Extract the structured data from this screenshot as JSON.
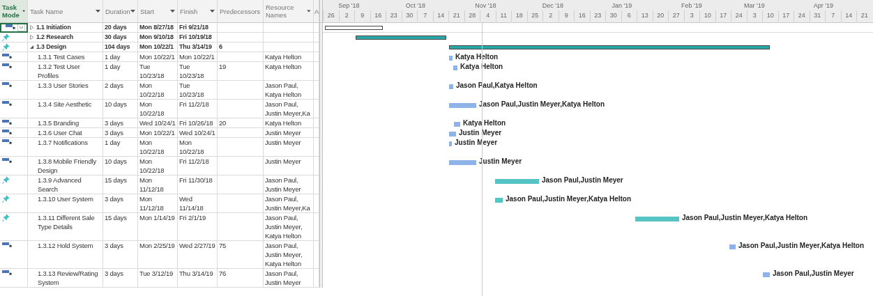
{
  "columns": [
    {
      "label": "Task Mode",
      "selected": true,
      "kind": "field"
    },
    {
      "label": "Task Name",
      "selected": false,
      "kind": "field"
    },
    {
      "label": "Duration",
      "selected": false,
      "kind": "field"
    },
    {
      "label": "Start",
      "selected": false,
      "kind": "field"
    },
    {
      "label": "Finish",
      "selected": false,
      "kind": "field"
    },
    {
      "label": "Predecessors",
      "selected": false,
      "kind": "field"
    },
    {
      "label": "Resource Names",
      "selected": false,
      "kind": "field"
    },
    {
      "label": "A",
      "selected": false,
      "kind": "add"
    }
  ],
  "timescale": {
    "months": [
      "Sep '18",
      "Oct '18",
      "Nov '18",
      "Dec '18",
      "Jan '19",
      "Feb '19",
      "Mar '19",
      "Apr '19"
    ],
    "weeks": [
      "26",
      "2",
      "9",
      "16",
      "23",
      "30",
      "7",
      "14",
      "21",
      "28",
      "4",
      "11",
      "18",
      "25",
      "2",
      "9",
      "16",
      "23",
      "30",
      "6",
      "13",
      "20",
      "27",
      "3",
      "10",
      "17",
      "24",
      "3",
      "10",
      "17",
      "24",
      "31",
      "7",
      "14",
      "21"
    ]
  },
  "rows": [
    {
      "kind": "auto",
      "selected": true,
      "summary": true,
      "expanded": false,
      "name": "1.1 Initiation",
      "duration": "20 days",
      "start": "Mon 8/27/18",
      "finish": "Fri 9/21/18"
    },
    {
      "kind": "manual",
      "selected": false,
      "summary": true,
      "expanded": false,
      "name": "1.2 Research",
      "duration": "30 days",
      "start": "Mon 9/10/18",
      "finish": "Fri 10/19/18"
    },
    {
      "kind": "manual",
      "selected": false,
      "summary": true,
      "expanded": true,
      "name": "1.3 Design",
      "duration": "104 days",
      "start": "Mon 10/22/1",
      "finish": "Thu 3/14/19",
      "predecessors": "6"
    },
    {
      "kind": "auto",
      "selected": false,
      "summary": false,
      "name": "1.3.1 Test Cases",
      "duration": "1 day",
      "start": "Mon 10/22/1",
      "finish": "Mon 10/22/1",
      "resources": "Katya Helton",
      "bar_label": "Katya Helton"
    },
    {
      "kind": "auto",
      "selected": false,
      "summary": false,
      "name": "1.3.2 Test User Profiles",
      "duration": "1 day",
      "start": "Tue 10/23/18",
      "finish": "Tue 10/23/18",
      "predecessors": "19",
      "resources": "Katya Helton",
      "bar_label": "Katya Helton"
    },
    {
      "kind": "auto",
      "selected": false,
      "summary": false,
      "name": "1.3.3 User Stories",
      "duration": "2 days",
      "start": "Mon 10/22/18",
      "finish": "Tue 10/23/18",
      "resources": "Jason Paul, Katya Helton",
      "bar_label": "Jason Paul,Katya Helton"
    },
    {
      "kind": "auto",
      "selected": false,
      "summary": false,
      "name": "1.3.4 Site Aesthetic",
      "duration": "10 days",
      "start": "Mon 10/22/18",
      "finish": "Fri 11/2/18",
      "resources": "Jason Paul, Justin Meyer,Ka",
      "bar_label": "Jason Paul,Justin Meyer,Katya Helton"
    },
    {
      "kind": "auto",
      "selected": false,
      "summary": false,
      "name": "1.3.5 Branding",
      "duration": "3 days",
      "start": "Wed 10/24/1",
      "finish": "Fri 10/26/18",
      "predecessors": "20",
      "resources": "Katya Helton",
      "bar_label": "Katya Helton"
    },
    {
      "kind": "auto",
      "selected": false,
      "summary": false,
      "name": "1.3.6 User Chat",
      "duration": "3 days",
      "start": "Mon 10/22/1",
      "finish": "Wed 10/24/1",
      "resources": "Justin Meyer",
      "bar_label": "Justin Meyer"
    },
    {
      "kind": "auto",
      "selected": false,
      "summary": false,
      "name": "1.3.7 Notifications",
      "duration": "1 day",
      "start": "Mon 10/22/18",
      "finish": "Mon 10/22/18",
      "resources": "Justin Meyer",
      "bar_label": "Justin Meyer"
    },
    {
      "kind": "auto",
      "selected": false,
      "summary": false,
      "name": "1.3.8 Mobile Friendly Design",
      "duration": "10 days",
      "start": "Mon 10/22/18",
      "finish": "Fri 11/2/18",
      "resources": "Justin Meyer",
      "bar_label": "Justin Meyer"
    },
    {
      "kind": "manual",
      "selected": false,
      "summary": false,
      "name": "1.3.9 Advanced Search",
      "duration": "15 days",
      "start": "Mon 11/12/18",
      "finish": "Fri 11/30/18",
      "resources": "Jason Paul, Justin Meyer",
      "bar_label": "Jason Paul,Justin Meyer"
    },
    {
      "kind": "manual",
      "selected": false,
      "summary": false,
      "name": "1.3.10 User System",
      "duration": "3 days",
      "start": "Mon 11/12/18",
      "finish": "Wed 11/14/18",
      "resources": "Jason Paul, Justin Meyer,Ka",
      "bar_label": "Jason Paul,Justin Meyer,Katya Helton"
    },
    {
      "kind": "manual",
      "selected": false,
      "summary": false,
      "name": "1.3.11 Different Sale Type Details",
      "duration": "15 days",
      "start": "Mon 1/14/19",
      "finish": "Fri 2/1/19",
      "resources": "Jason Paul, Justin Meyer, Katya Helton",
      "bar_label": "Jason Paul,Justin Meyer,Katya Helton"
    },
    {
      "kind": "auto",
      "selected": false,
      "summary": false,
      "name": "1.3.12 Hold System",
      "duration": "3 days",
      "start": "Mon 2/25/19",
      "finish": "Wed 2/27/19",
      "predecessors": "75",
      "resources": "Jason Paul, Justin Meyer, Katya Helton",
      "bar_label": "Jason Paul,Justin Meyer,Katya Helton"
    },
    {
      "kind": "auto",
      "selected": false,
      "summary": false,
      "name": "1.3.13 Review/Rating System",
      "duration": "3 days",
      "start": "Tue 3/12/19",
      "finish": "Thu 3/14/19",
      "predecessors": "76",
      "resources": "Jason Paul, Justin Meyer",
      "bar_label": "Jason Paul,Justin Meyer"
    }
  ]
}
